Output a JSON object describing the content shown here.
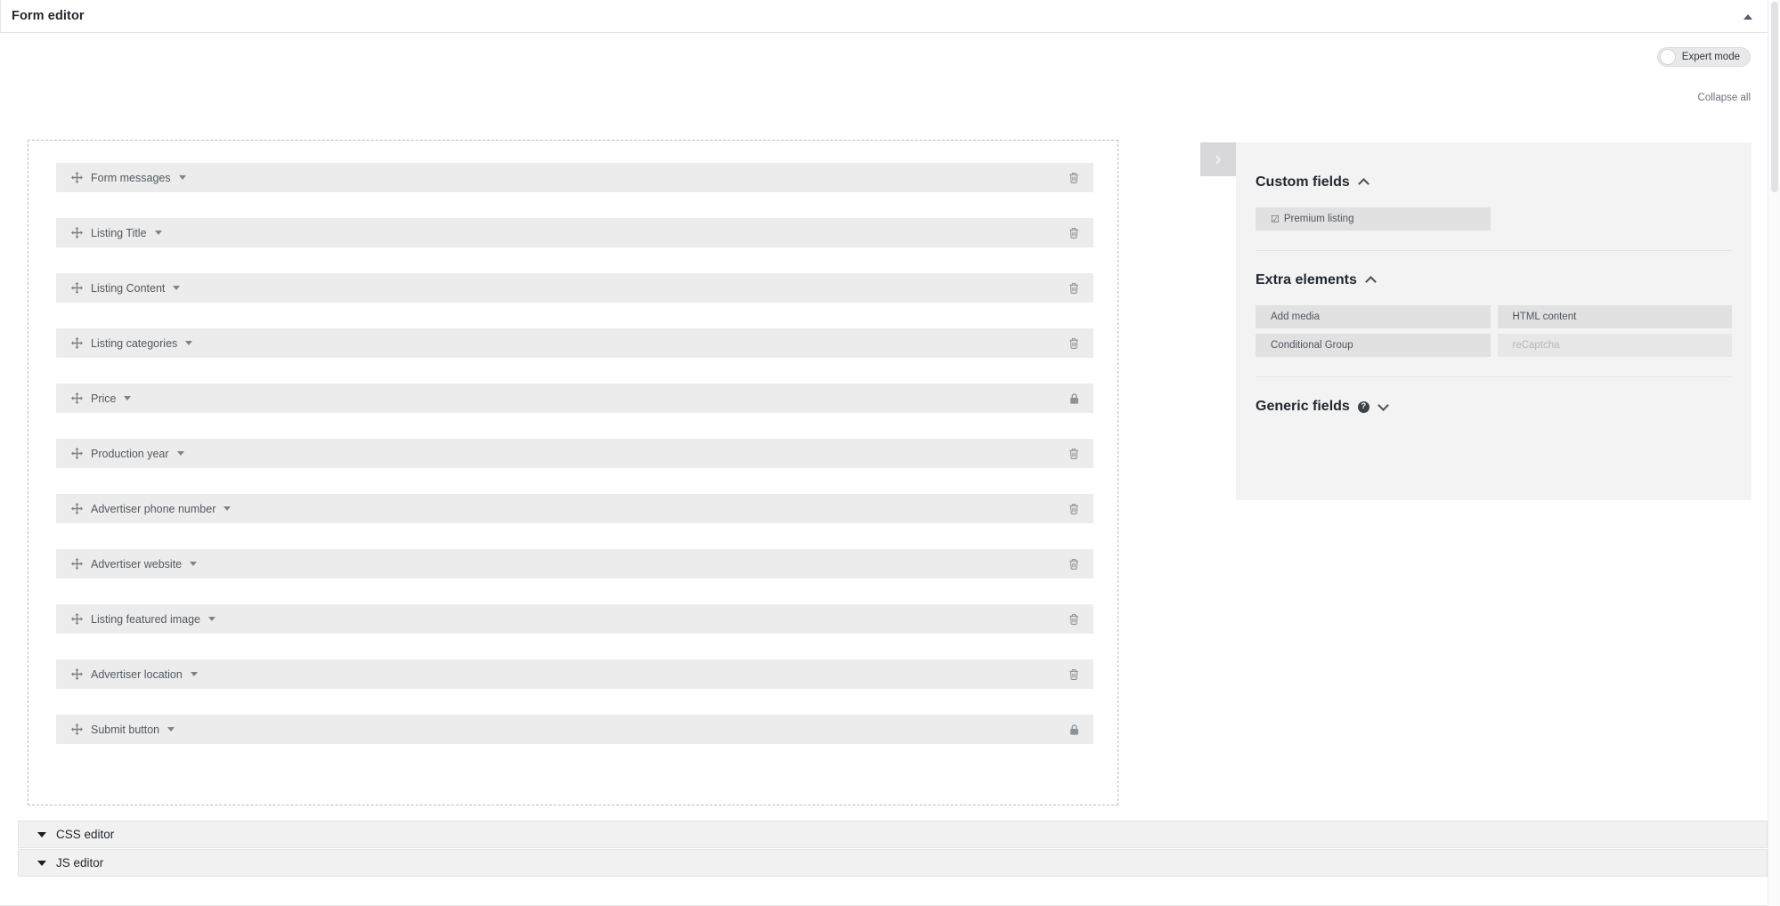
{
  "titlebar": {
    "title": "Form editor",
    "collapse_icon": "caret-up-icon"
  },
  "toolbar": {
    "expert_mode_label": "Expert mode",
    "expert_mode_on": false,
    "collapse_all_label": "Collapse all"
  },
  "canvas": {
    "fields": [
      {
        "label": "Form messages",
        "action": "trash",
        "caret": true
      },
      {
        "label": "Listing Title",
        "action": "trash",
        "caret": true
      },
      {
        "label": "Listing Content",
        "action": "trash",
        "caret": true
      },
      {
        "label": "Listing categories",
        "action": "trash",
        "caret": true
      },
      {
        "label": "Price",
        "action": "lock",
        "caret": true
      },
      {
        "label": "Production year",
        "action": "trash",
        "caret": true
      },
      {
        "label": "Advertiser phone number",
        "action": "trash",
        "caret": true
      },
      {
        "label": "Advertiser website",
        "action": "trash",
        "caret": true
      },
      {
        "label": "Listing featured image",
        "action": "trash",
        "caret": true
      },
      {
        "label": "Advertiser location",
        "action": "trash",
        "caret": true
      },
      {
        "label": "Submit button",
        "action": "lock",
        "caret": true
      }
    ]
  },
  "sidebar": {
    "toggle_icon": "chevron-right-icon",
    "sections": [
      {
        "title": "Custom fields",
        "state": "expanded",
        "chevron": "chevron-up-icon",
        "items": [
          {
            "label": "Premium listing",
            "icon": "checkbox-checked-icon",
            "disabled": false
          }
        ]
      },
      {
        "title": "Extra elements",
        "state": "expanded",
        "chevron": "chevron-up-icon",
        "items": [
          {
            "label": "Add media",
            "disabled": false
          },
          {
            "label": "HTML content",
            "disabled": false
          },
          {
            "label": "Conditional Group",
            "disabled": false
          },
          {
            "label": "reCaptcha",
            "disabled": true
          }
        ]
      },
      {
        "title": "Generic fields",
        "state": "collapsed",
        "chevron": "chevron-down-icon",
        "help": "?",
        "items": []
      }
    ]
  },
  "bottom_panels": [
    {
      "label": "CSS editor",
      "icon": "caret-down-icon"
    },
    {
      "label": "JS editor",
      "icon": "caret-down-icon"
    }
  ],
  "colors": {
    "page_bg": "#ffffff",
    "row_bg": "#ececec",
    "sidebar_bg": "#f3f3f4",
    "chip_bg": "#e1e1e2",
    "text": "#23282d",
    "muted_text": "#6d7278"
  }
}
